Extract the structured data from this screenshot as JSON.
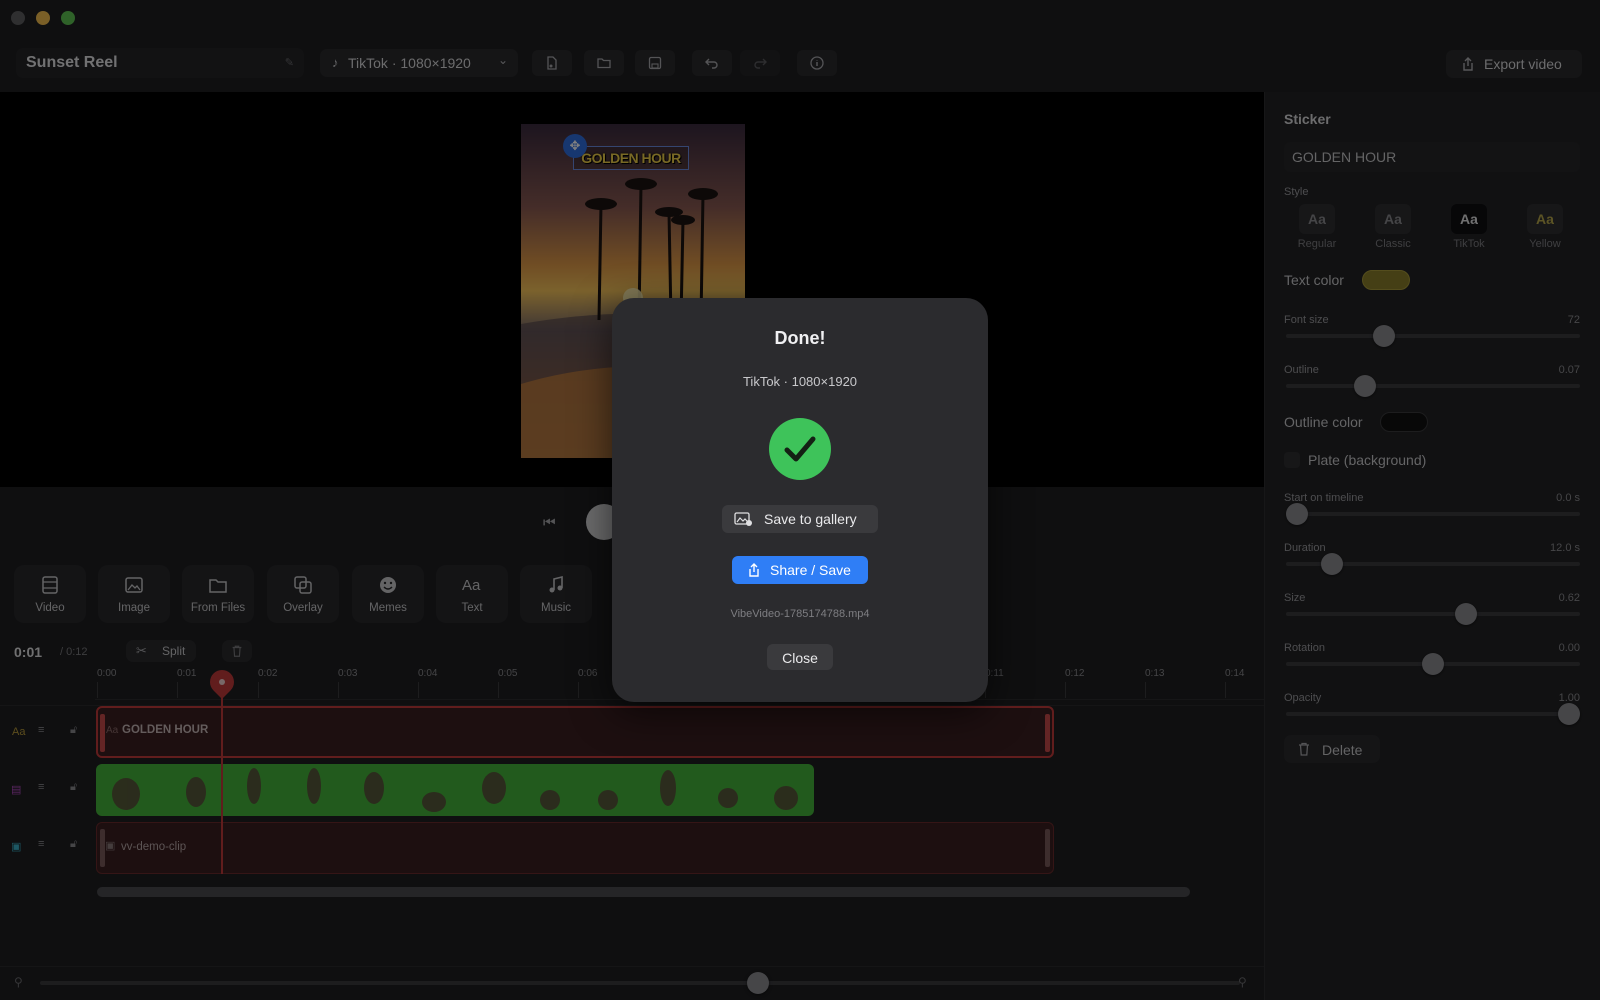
{
  "window": {
    "traffic_lights": [
      "#5e5e61",
      "#f5bf4f",
      "#5fc453"
    ]
  },
  "toolbar": {
    "project_title": "Sunset Reel",
    "format_label": "TikTok · 1080×1920",
    "export_label": "Export video"
  },
  "preview": {
    "sticker_text": "GOLDEN HOUR"
  },
  "tools": [
    {
      "label": "Video",
      "icon": "film-icon"
    },
    {
      "label": "Image",
      "icon": "image-icon"
    },
    {
      "label": "From Files",
      "icon": "folder-icon"
    },
    {
      "label": "Overlay",
      "icon": "overlay-icon"
    },
    {
      "label": "Memes",
      "icon": "smiley-icon"
    },
    {
      "label": "Text",
      "icon": "text-icon"
    },
    {
      "label": "Music",
      "icon": "music-note-icon"
    }
  ],
  "timeline": {
    "current_time": "0:01",
    "total_time": "/ 0:12",
    "split_label": "Split",
    "ruler": [
      "0:00",
      "0:01",
      "0:02",
      "0:03",
      "0:04",
      "0:05",
      "0:06",
      "0:11",
      "0:12",
      "0:13",
      "0:14"
    ],
    "tracks": [
      {
        "label": "GOLDEN HOUR",
        "type_glyph": "Aa"
      },
      {
        "label": "",
        "type_glyph": ""
      },
      {
        "label": "vv-demo-clip",
        "type_glyph": ""
      }
    ]
  },
  "panel": {
    "title": "Sticker",
    "text_value": "GOLDEN HOUR",
    "style_label": "Style",
    "styles": [
      {
        "glyph": "Aa",
        "name": "Regular"
      },
      {
        "glyph": "Aa",
        "name": "Classic"
      },
      {
        "glyph": "Aa",
        "name": "TikTok"
      },
      {
        "glyph": "Aa",
        "name": "Yellow"
      }
    ],
    "text_color_label": "Text color",
    "text_color": "#8a7e2a",
    "sliders": [
      {
        "label": "Font size",
        "value": "72",
        "fraction": 0.32
      },
      {
        "label": "Outline",
        "value": "0.07",
        "fraction": 0.25
      },
      {
        "label": "Start on timeline",
        "value": "0.0 s",
        "fraction": 0.0
      },
      {
        "label": "Duration",
        "value": "12.0 s",
        "fraction": 0.13
      },
      {
        "label": "Size",
        "value": "0.62",
        "fraction": 0.62
      },
      {
        "label": "Rotation",
        "value": "0.00",
        "fraction": 0.5
      },
      {
        "label": "Opacity",
        "value": "1.00",
        "fraction": 1.0
      }
    ],
    "outline_color_label": "Outline color",
    "outline_color": "#111111",
    "plate_label": "Plate (background)",
    "delete_label": "Delete"
  },
  "zoom_fraction": 0.6,
  "modal": {
    "title": "Done!",
    "subtitle": "TikTok · 1080×1920",
    "save_gallery_label": "Save to gallery",
    "share_label": "Share / Save",
    "filename": "VibeVideo-1785174788.mp4",
    "close_label": "Close",
    "success_color": "#3ec35a",
    "accent": "#2f7ef6"
  }
}
